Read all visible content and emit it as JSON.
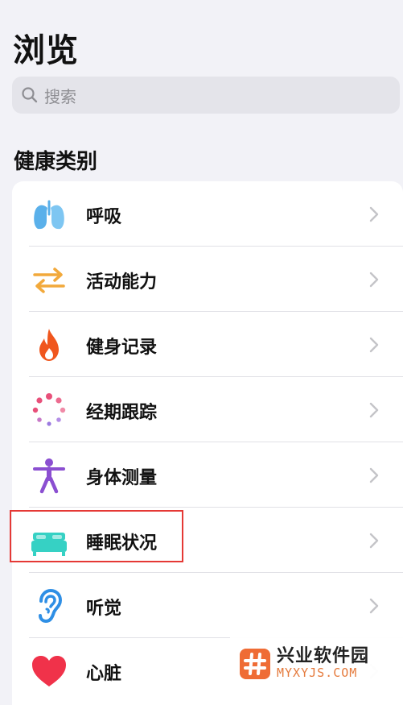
{
  "header": {
    "title": "浏览"
  },
  "search": {
    "placeholder": "搜索"
  },
  "section": {
    "title": "健康类别"
  },
  "categories": [
    {
      "label": "呼吸",
      "icon": "lungs-icon",
      "color": "#5ab0ea"
    },
    {
      "label": "活动能力",
      "icon": "arrows-icon",
      "color": "#f2a93b"
    },
    {
      "label": "健身记录",
      "icon": "flame-icon",
      "color": "#f0561d"
    },
    {
      "label": "经期跟踪",
      "icon": "dots-circle-icon",
      "color": "#e8507a"
    },
    {
      "label": "身体测量",
      "icon": "person-icon",
      "color": "#8b4fd1"
    },
    {
      "label": "睡眠状况",
      "icon": "bed-icon",
      "color": "#36d1c4"
    },
    {
      "label": "听觉",
      "icon": "ear-icon",
      "color": "#2f8fe5"
    },
    {
      "label": "心脏",
      "icon": "heart-icon",
      "color": "#f0324a"
    }
  ],
  "highlight": {
    "target": "睡眠状况",
    "color": "#e53935"
  },
  "watermark": {
    "title": "兴业软件园",
    "subtitle": "MYXYJS.COM"
  }
}
